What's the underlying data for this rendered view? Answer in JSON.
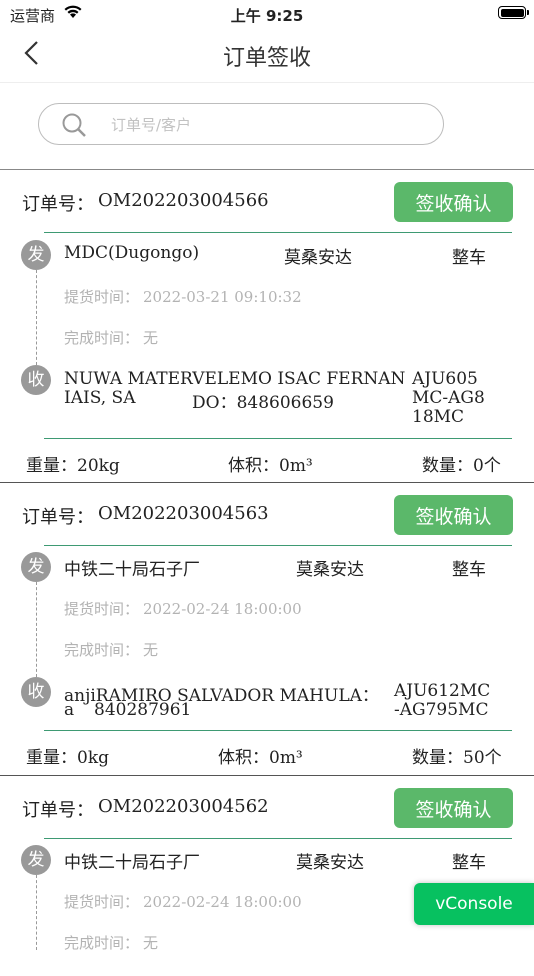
{
  "status_bar": {
    "carrier": "运营商",
    "time": "上午 9:25"
  },
  "nav": {
    "title": "订单签收"
  },
  "search": {
    "placeholder": "订单号/客户"
  },
  "labels": {
    "order_no": "订单号：",
    "confirm": "签收确认",
    "send_badge": "发",
    "receive_badge": "收",
    "pickup_time": "提货时间：",
    "finish_time": "完成时间：",
    "weight": "重量：",
    "volume": "体积：",
    "quantity": "数量："
  },
  "orders": [
    {
      "order_no": "OM202203004566",
      "sender": "MDC(Dugongo)",
      "destination": "莫桑安达",
      "type": "整车",
      "pickup_time": "2022-03-21 09:10:32",
      "finish_time": "无",
      "receiver_line1": "NUWA MATERVELEMO ISAC FERNAN",
      "receiver_line2a": "IAIS, SA",
      "receiver_line2b": "DO：848606659",
      "plate": [
        "AJU605",
        "MC-AG8",
        "18MC"
      ],
      "weight": "20kg",
      "volume": "0m³",
      "quantity": "0个"
    },
    {
      "order_no": "OM202203004563",
      "sender": "中铁二十局石子厂",
      "destination": "莫桑安达",
      "type": "整车",
      "pickup_time": "2022-02-24 18:00:00",
      "finish_time": "无",
      "receiver_line1": "anjiRAMIRO SALVADOR MAHULA：",
      "receiver_line2a": "a",
      "receiver_line2b": "840287961",
      "plate": [
        "AJU612MC",
        "-AG795MC"
      ],
      "weight": "0kg",
      "volume": "0m³",
      "quantity": "50个"
    },
    {
      "order_no": "OM202203004562",
      "sender": "中铁二十局石子厂",
      "destination": "莫桑安达",
      "type": "整车",
      "pickup_time": "2022-02-24 18:00:00",
      "finish_time": "无"
    }
  ],
  "vconsole": {
    "label": "vConsole"
  }
}
